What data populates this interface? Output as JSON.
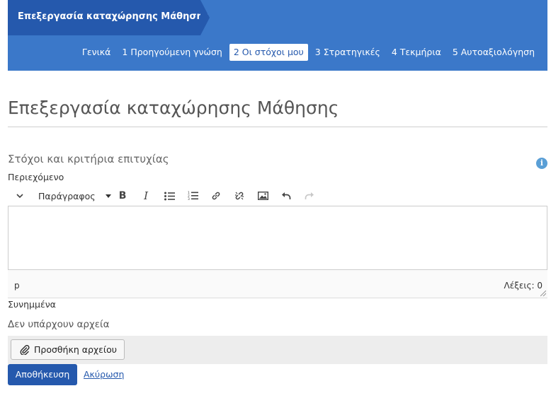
{
  "header": {
    "breadcrumb": "Επεξεργασία καταχώρησης Μάθησης",
    "tabs": [
      {
        "label": "Γενικά",
        "active": false
      },
      {
        "label": "1 Προηγούμενη γνώση",
        "active": false
      },
      {
        "label": "2 Οι στόχοι μου",
        "active": true
      },
      {
        "label": "3 Στρατηγικές",
        "active": false
      },
      {
        "label": "4 Τεκμήρια",
        "active": false
      },
      {
        "label": "5 Αυτοαξιολόγηση",
        "active": false
      }
    ]
  },
  "page": {
    "title": "Επεξεργασία καταχώρησης Μάθησης"
  },
  "section": {
    "title": "Στόχοι και κριτήρια επιτυχίας",
    "info_icon": "info-icon",
    "content_label": "Περιεχόμενο"
  },
  "editor": {
    "format_select": "Παράγραφος",
    "toolbar_icons": [
      "chevron-down-icon",
      "bold-icon",
      "italic-icon",
      "bullet-list-icon",
      "numbered-list-icon",
      "link-icon",
      "unlink-icon",
      "image-icon",
      "undo-icon",
      "redo-icon"
    ],
    "path": "p",
    "word_count": "Λέξεις: 0"
  },
  "attachments": {
    "label": "Συνημμένα",
    "empty_text": "Δεν υπάρχουν αρχεία",
    "add_button": "Προσθήκη αρχείου"
  },
  "actions": {
    "save": "Αποθήκευση",
    "cancel": "Ακύρωση"
  },
  "colors": {
    "header_bg": "#3b78c9",
    "breadcrumb_bg": "#2559ad",
    "primary": "#2559ad",
    "info": "#5a9fd6"
  }
}
